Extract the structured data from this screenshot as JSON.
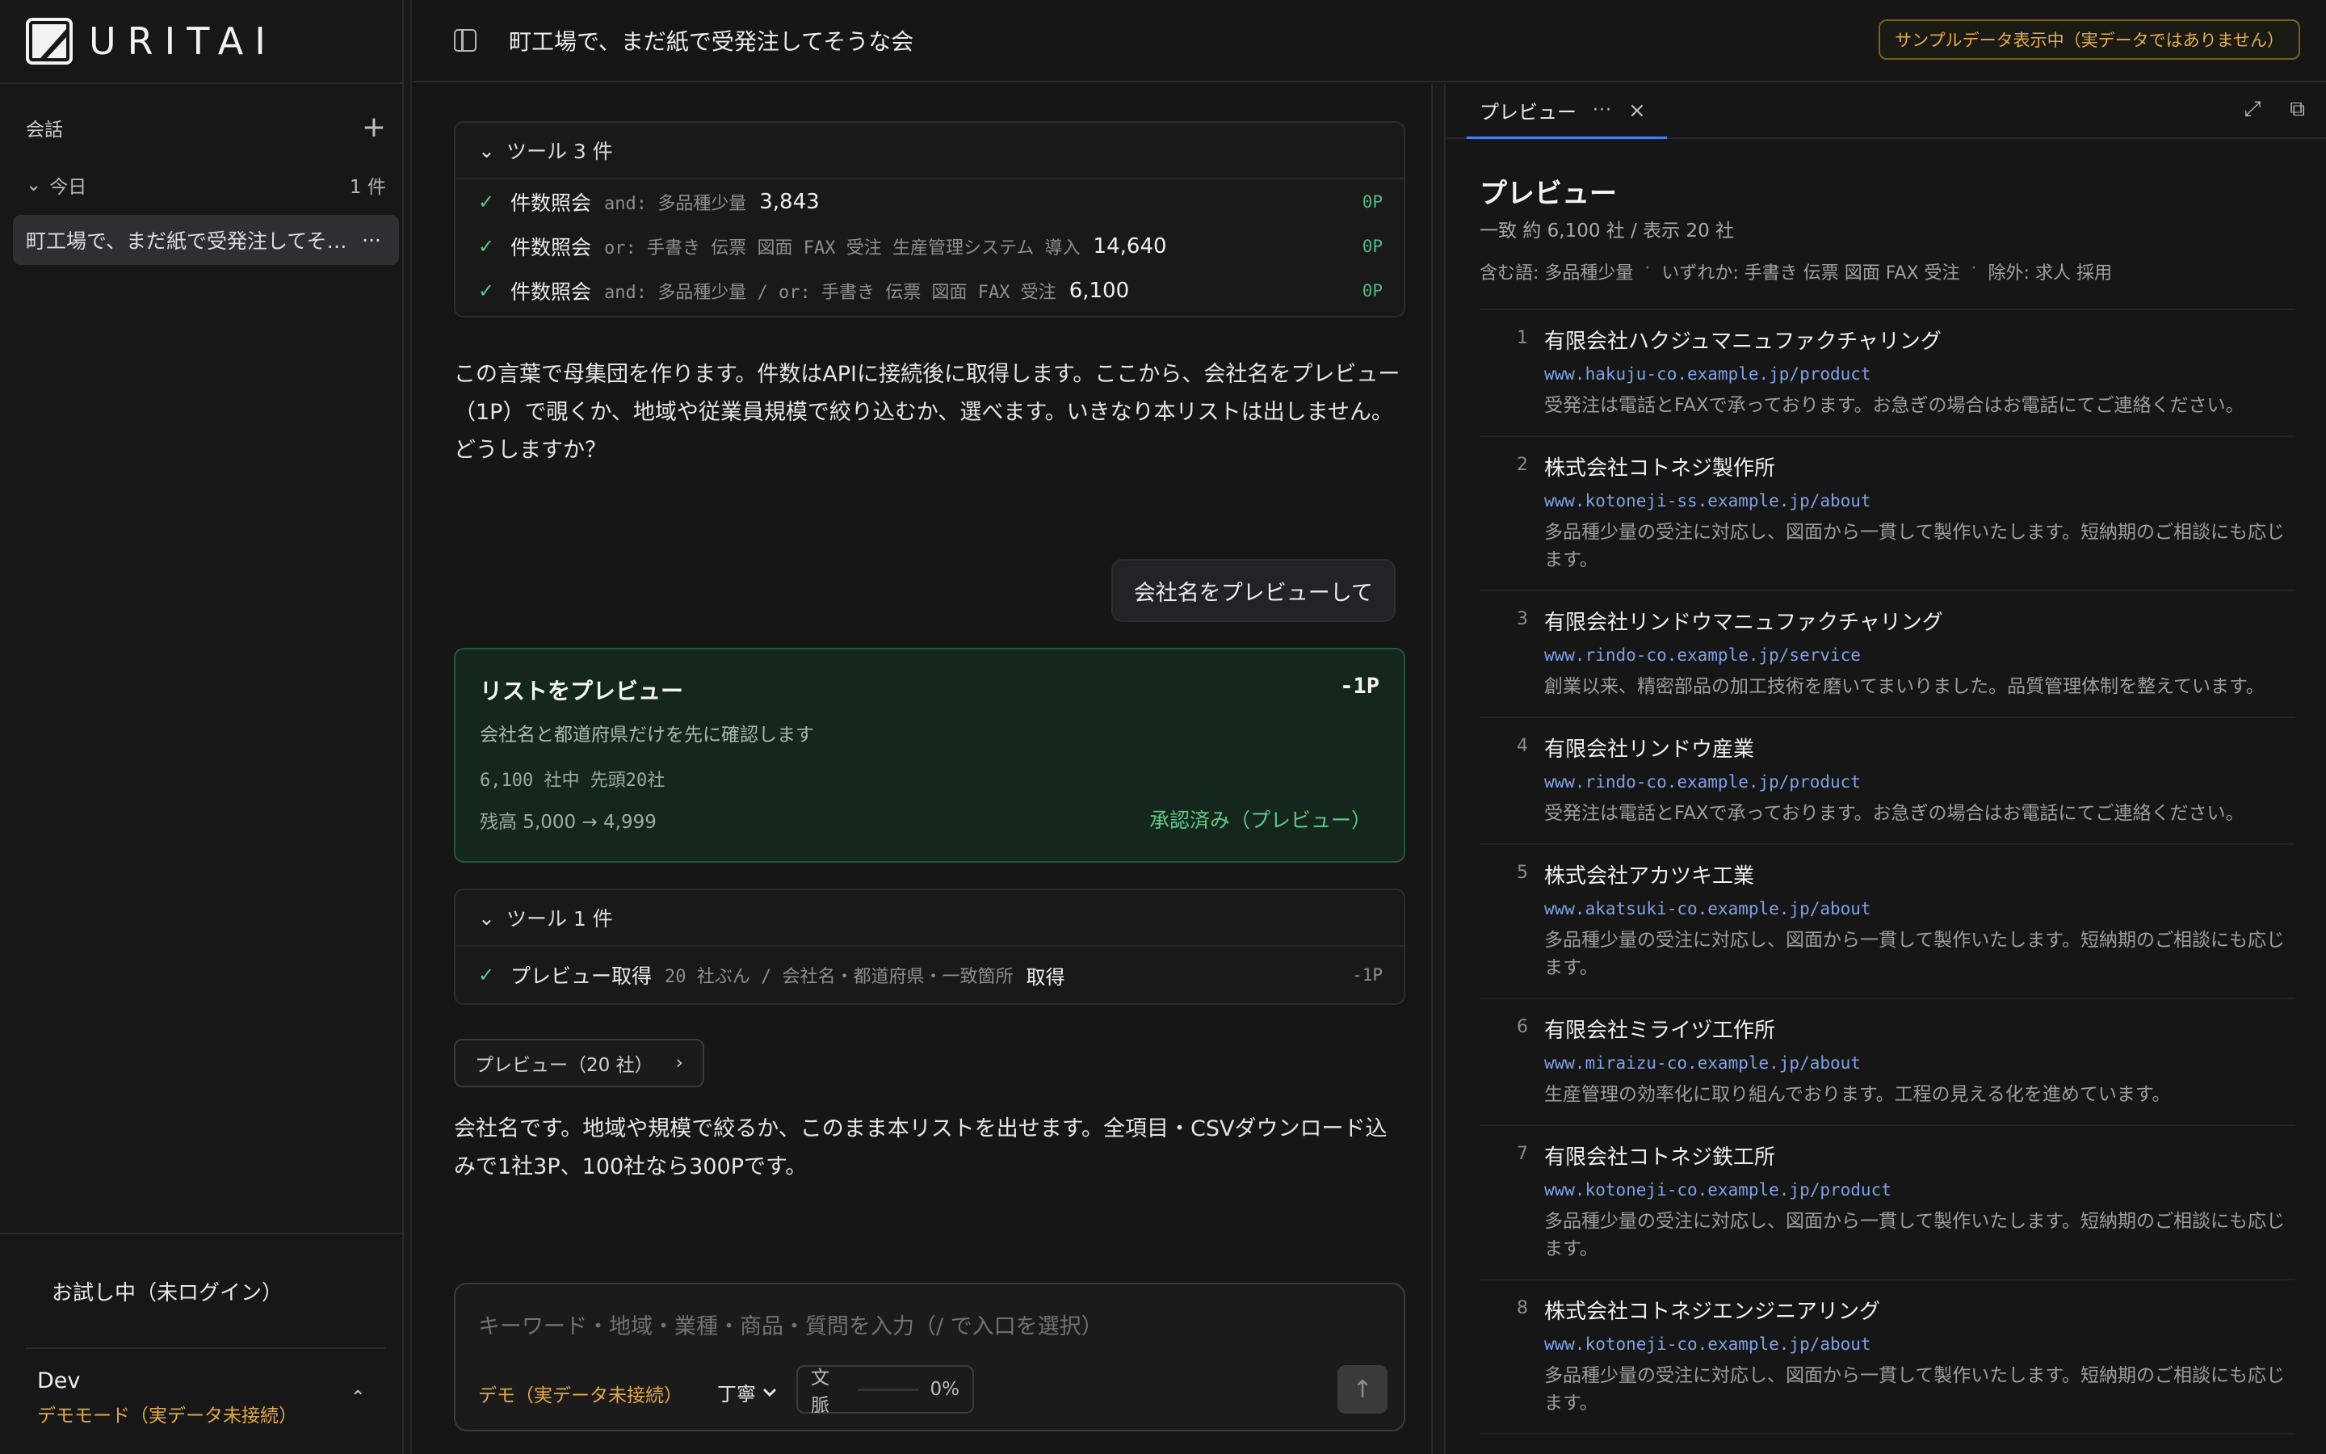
{
  "app": {
    "brand": "URITAI"
  },
  "sidebar": {
    "section_label": "会話",
    "group_label": "今日",
    "group_count": "1 件",
    "conversation": "町工場で、まだ紙で受発注してそうな会",
    "trial_status": "お試し中（未ログイン）",
    "user_name": "Dev",
    "user_mode": "デモモード（実データ未接続）"
  },
  "header": {
    "title": "町工場で、まだ紙で受発注してそうな会",
    "sample_badge": "サンプルデータ表示中（実データではありません）"
  },
  "chat": {
    "tools1": {
      "label": "ツール 3 件",
      "rows": [
        {
          "name": "件数照会",
          "query": "and: 多品種少量",
          "count": "3,843",
          "points": "0P"
        },
        {
          "name": "件数照会",
          "query": "or: 手書き 伝票 図面 FAX 受注 生産管理システム 導入",
          "count": "14,640",
          "points": "0P"
        },
        {
          "name": "件数照会",
          "query": "and: 多品種少量 / or: 手書き 伝票 図面 FAX 受注",
          "count": "6,100",
          "points": "0P"
        }
      ]
    },
    "assistant_msg1": "この言葉で母集団を作ります。件数はAPIに接続後に取得します。ここから、会社名をプレビュー（1P）で覗くか、地域や従業員規模で絞り込むか、選べます。いきなり本リストは出しません。どうしますか？",
    "user_msg": "会社名をプレビューして",
    "preview_card": {
      "title": "リストをプレビュー",
      "cost": "-1P",
      "subtitle": "会社名と都道府県だけを先に確認します",
      "meta": "6,100 社中 先頭20社",
      "balance": "残高 5,000 → 4,999",
      "status": "承認済み（プレビュー）"
    },
    "tools2": {
      "label": "ツール 1 件",
      "rows": [
        {
          "name": "プレビュー取得",
          "query": "20 社ぶん / 会社名・都道府県・一致箇所",
          "count": "取得",
          "points": "-1P"
        }
      ]
    },
    "preview_button": "プレビュー（20 社）",
    "assistant_msg2": "会社名です。地域や規模で絞るか、このまま本リストを出せます。全項目・CSVダウンロード込みで1社3P、100社なら300Pです。",
    "composer": {
      "placeholder": "キーワード・地域・業種・商品・質問を入力（/ で入口を選択）",
      "demo": "デモ（実データ未接続）",
      "tone": "丁寧",
      "context_label": "文脈",
      "context_value": "0%"
    }
  },
  "panel": {
    "tab_label": "プレビュー",
    "title": "プレビュー",
    "count": "一致 約 6,100 社 / 表示 20 社",
    "filter_include": "含む語: 多品種少量",
    "filter_any": "いずれか: 手書き 伝票 図面 FAX 受注",
    "filter_exclude": "除外: 求人 採用",
    "items": [
      {
        "num": "1",
        "name": "有限会社ハクジュマニュファクチャリング",
        "url": "www.hakuju-co.example.jp/product",
        "desc": "受発注は電話とFAXで承っております。お急ぎの場合はお電話にてご連絡ください。"
      },
      {
        "num": "2",
        "name": "株式会社コトネジ製作所",
        "url": "www.kotoneji-ss.example.jp/about",
        "desc": "多品種少量の受注に対応し、図面から一貫して製作いたします。短納期のご相談にも応じます。"
      },
      {
        "num": "3",
        "name": "有限会社リンドウマニュファクチャリング",
        "url": "www.rindo-co.example.jp/service",
        "desc": "創業以来、精密部品の加工技術を磨いてまいりました。品質管理体制を整えています。"
      },
      {
        "num": "4",
        "name": "有限会社リンドウ産業",
        "url": "www.rindo-co.example.jp/product",
        "desc": "受発注は電話とFAXで承っております。お急ぎの場合はお電話にてご連絡ください。"
      },
      {
        "num": "5",
        "name": "株式会社アカツキ工業",
        "url": "www.akatsuki-co.example.jp/about",
        "desc": "多品種少量の受注に対応し、図面から一貫して製作いたします。短納期のご相談にも応じます。"
      },
      {
        "num": "6",
        "name": "有限会社ミライヅ工作所",
        "url": "www.miraizu-co.example.jp/about",
        "desc": "生産管理の効率化に取り組んでおります。工程の見える化を進めています。"
      },
      {
        "num": "7",
        "name": "有限会社コトネジ鉄工所",
        "url": "www.kotoneji-co.example.jp/product",
        "desc": "多品種少量の受注に対応し、図面から一貫して製作いたします。短納期のご相談にも応じます。"
      },
      {
        "num": "8",
        "name": "株式会社コトネジエンジニアリング",
        "url": "www.kotoneji-co.example.jp/about",
        "desc": "多品種少量の受注に対応し、図面から一貫して製作いたします。短納期のご相談にも応じます。"
      }
    ]
  }
}
